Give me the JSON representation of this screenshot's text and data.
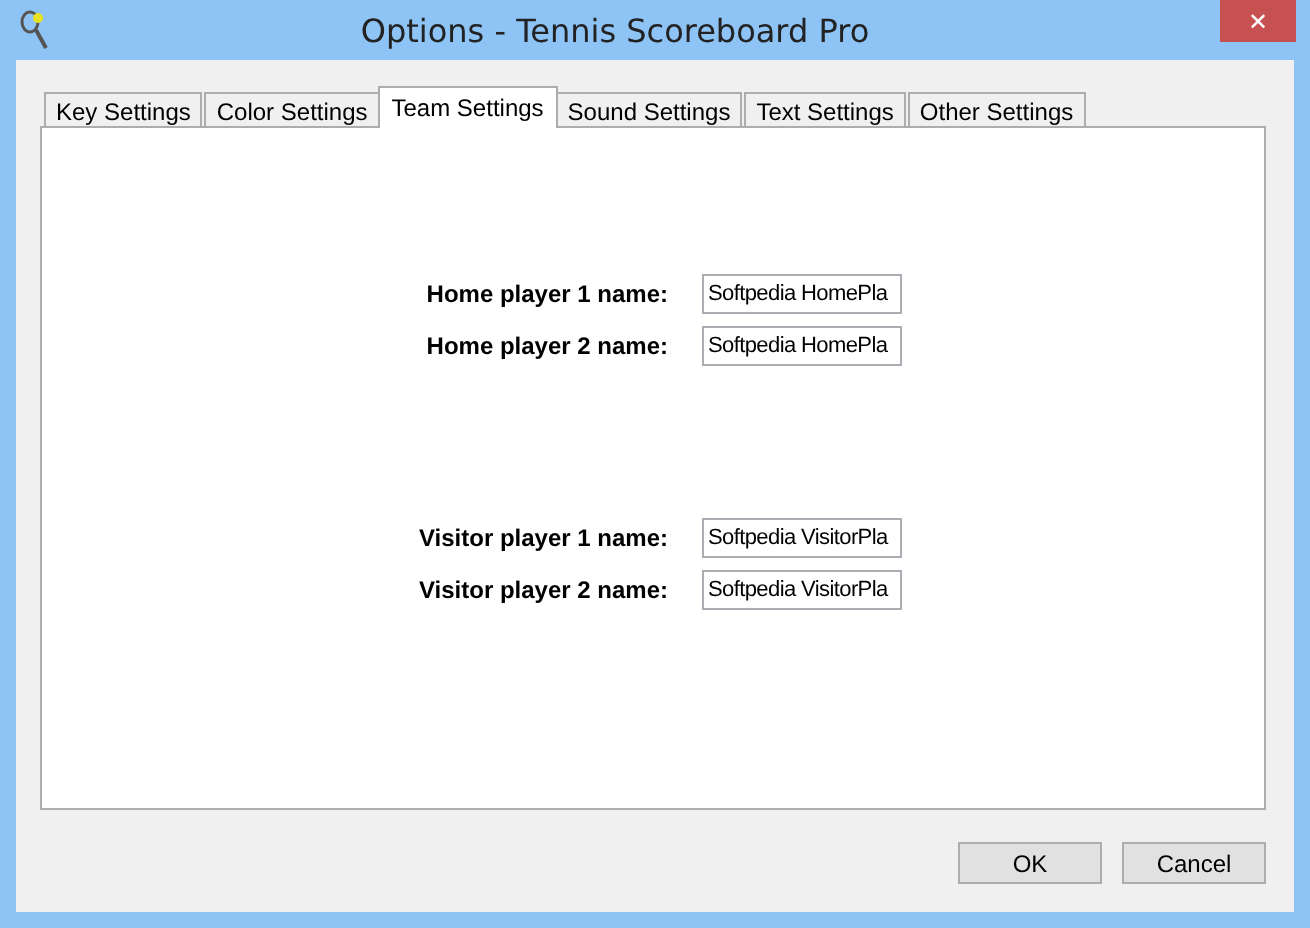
{
  "window": {
    "title": "Options - Tennis Scoreboard Pro",
    "close": "✕"
  },
  "tabs": [
    {
      "label": "Key Settings",
      "selected": false
    },
    {
      "label": "Color Settings",
      "selected": false
    },
    {
      "label": "Team Settings",
      "selected": true
    },
    {
      "label": "Sound Settings",
      "selected": false
    },
    {
      "label": "Text Settings",
      "selected": false
    },
    {
      "label": "Other Settings",
      "selected": false
    }
  ],
  "home_players": [
    {
      "label": "Home player 1 name:",
      "value": "Softpedia HomePla"
    },
    {
      "label": "Home player 2 name:",
      "value": "Softpedia HomePla"
    }
  ],
  "visitor_players": [
    {
      "label": "Visitor player 1 name:",
      "value": "Softpedia VisitorPla"
    },
    {
      "label": "Visitor player 2 name:",
      "value": "Softpedia VisitorPla"
    }
  ],
  "buttons": [
    "OK",
    "Cancel"
  ]
}
